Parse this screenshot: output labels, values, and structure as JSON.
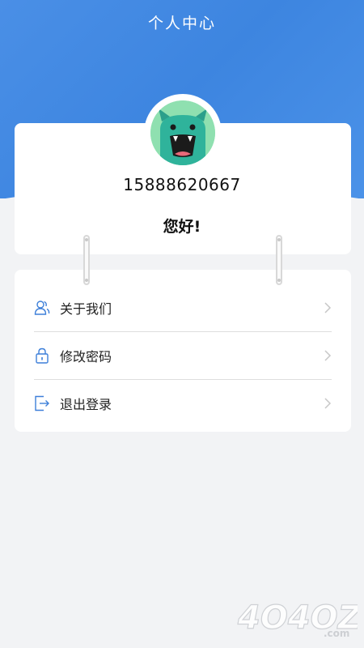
{
  "header": {
    "title": "个人中心"
  },
  "profile": {
    "phone": "15888620667",
    "greeting": "您好!"
  },
  "menu": {
    "items": [
      {
        "label": "关于我们",
        "icon": "users-icon"
      },
      {
        "label": "修改密码",
        "icon": "lock-icon"
      },
      {
        "label": "退出登录",
        "icon": "logout-icon"
      }
    ]
  },
  "watermark": {
    "text": "4O4OZ",
    "suffix": ".com"
  },
  "colors": {
    "header_blue": "#4a8fe6",
    "icon_blue": "#3d7fd9",
    "chevron": "#c7c7c7",
    "avatar_bg": "#8fe0b0"
  }
}
